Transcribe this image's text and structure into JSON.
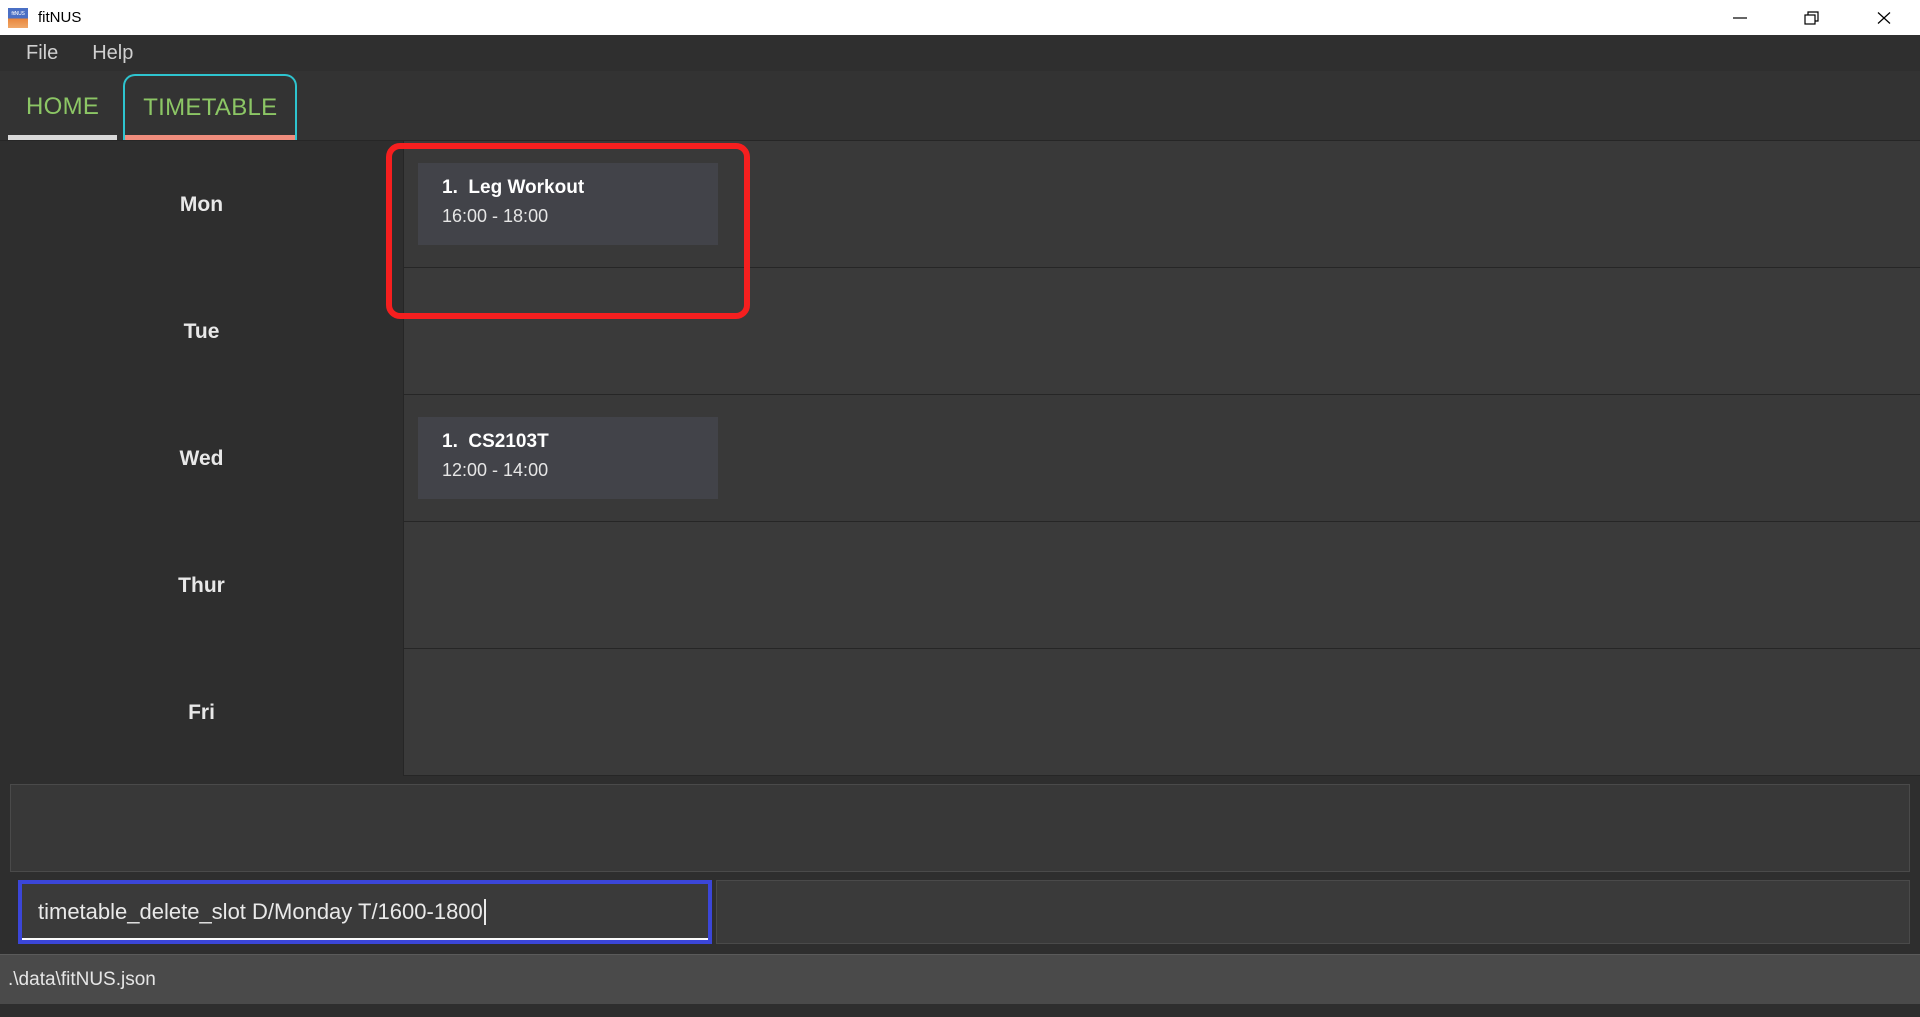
{
  "window": {
    "title": "fitNUS",
    "icon": "app-icon",
    "controls": [
      {
        "name": "minimize",
        "glyph": "minimize-icon"
      },
      {
        "name": "restore",
        "glyph": "restore-icon"
      },
      {
        "name": "close",
        "glyph": "close-icon"
      }
    ]
  },
  "menubar": {
    "items": [
      {
        "label": "File"
      },
      {
        "label": "Help"
      }
    ]
  },
  "tabs": {
    "items": [
      {
        "label": "HOME",
        "selected": false
      },
      {
        "label": "TIMETABLE",
        "selected": true
      }
    ],
    "accent_green": "#8cc665",
    "highlight_cyan": "#2ec4cf",
    "active_underline": "#f08d7d",
    "inactive_underline": "#d9d9d9"
  },
  "timetable": {
    "days": [
      {
        "label": "Mon",
        "events": [
          {
            "index": "1.",
            "title": "Leg Workout",
            "time": "16:00 - 18:00"
          }
        ]
      },
      {
        "label": "Tue",
        "events": []
      },
      {
        "label": "Wed",
        "events": [
          {
            "index": "1.",
            "title": "CS2103T",
            "time": "12:00 - 14:00"
          }
        ]
      },
      {
        "label": "Thur",
        "events": []
      },
      {
        "label": "Fri",
        "events": []
      }
    ]
  },
  "annotation": {
    "color": "#f51f1f",
    "target": "mon-slot-row"
  },
  "result_display": {
    "text": ""
  },
  "command": {
    "value": "timetable_delete_slot D/Monday T/1600-1800",
    "placeholder": "Enter command here...",
    "border_color": "#3b46d8",
    "focused": true
  },
  "statusbar": {
    "path": ".\\data\\fitNUS.json"
  }
}
